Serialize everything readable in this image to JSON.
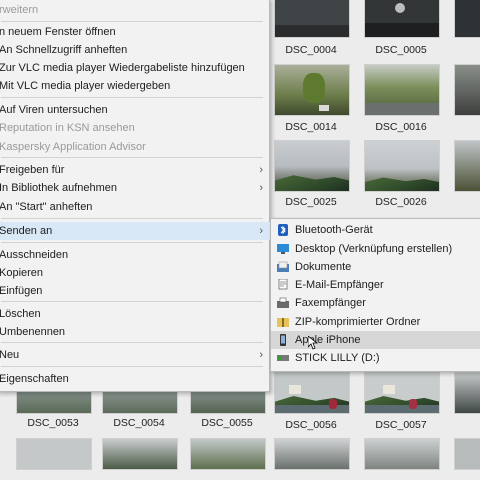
{
  "explorer": {
    "thumbnails": [
      {
        "label": "DSC_0004",
        "bg": "#4d4d4d"
      },
      {
        "label": "DSC_0005",
        "bg": "#3c3c3c"
      },
      {
        "label": "DSC_0014",
        "bg": "#8f9b7a"
      },
      {
        "label": "DSC_0016",
        "bg": "#83906b"
      },
      {
        "label": "DSC_0025",
        "bg": "#aeb4b8"
      },
      {
        "label": "DSC_0026",
        "bg": "#b4b8bb"
      },
      {
        "label": "DSC_0053",
        "bg": "#8aa0a6"
      },
      {
        "label": "DSC_0054",
        "bg": "#98a2a5"
      },
      {
        "label": "DSC_0055",
        "bg": "#93a3a5"
      },
      {
        "label": "DSC_0056",
        "bg": "#b5b9b8"
      },
      {
        "label": "DSC_0057",
        "bg": "#b9bdbc"
      }
    ]
  },
  "context_menu": {
    "items": [
      {
        "label": "rweitern",
        "disabled": true
      },
      {
        "label": "n neuem Fenster öffnen"
      },
      {
        "label": "An Schnellzugriff anheften"
      },
      {
        "label": "Zur VLC media player Wiedergabeliste hinzufügen"
      },
      {
        "label": "Mit VLC media player wiedergeben"
      },
      {
        "label": "Auf Viren untersuchen"
      },
      {
        "label": "Reputation in KSN ansehen",
        "disabled": true
      },
      {
        "label": "Kaspersky Application Advisor",
        "disabled": true
      },
      {
        "label": "Freigeben für",
        "arrow": true
      },
      {
        "label": "In Bibliothek aufnehmen",
        "arrow": true
      },
      {
        "label": "An \"Start\" anheften"
      },
      {
        "label": "Senden an",
        "arrow": true,
        "highlighted": true
      },
      {
        "label": "Ausschneiden"
      },
      {
        "label": "Kopieren"
      },
      {
        "label": "Einfügen"
      },
      {
        "label": "Löschen"
      },
      {
        "label": "Umbenennen"
      },
      {
        "label": "Neu",
        "arrow": true
      },
      {
        "label": "Eigenschaften"
      }
    ],
    "arrow_glyph": "›"
  },
  "send_to_menu": {
    "items": [
      {
        "label": "Bluetooth-Gerät",
        "icon": "bluetooth-icon"
      },
      {
        "label": "Desktop (Verknüpfung erstellen)",
        "icon": "desktop-icon"
      },
      {
        "label": "Dokumente",
        "icon": "documents-icon"
      },
      {
        "label": "E-Mail-Empfänger",
        "icon": "mail-icon"
      },
      {
        "label": "Faxempfänger",
        "icon": "fax-icon"
      },
      {
        "label": "ZIP-komprimierter Ordner",
        "icon": "zip-folder-icon"
      },
      {
        "label": "Apple iPhone",
        "icon": "iphone-icon",
        "highlighted": true
      },
      {
        "label": "STICK LILLY (D:)",
        "icon": "usb-drive-icon"
      }
    ]
  },
  "colors": {
    "menu_bg": "#f2f2f2",
    "menu_highlight": "#d9e8f7",
    "submenu_highlight": "#d7d7d7",
    "disabled_text": "#9a9a9a"
  }
}
